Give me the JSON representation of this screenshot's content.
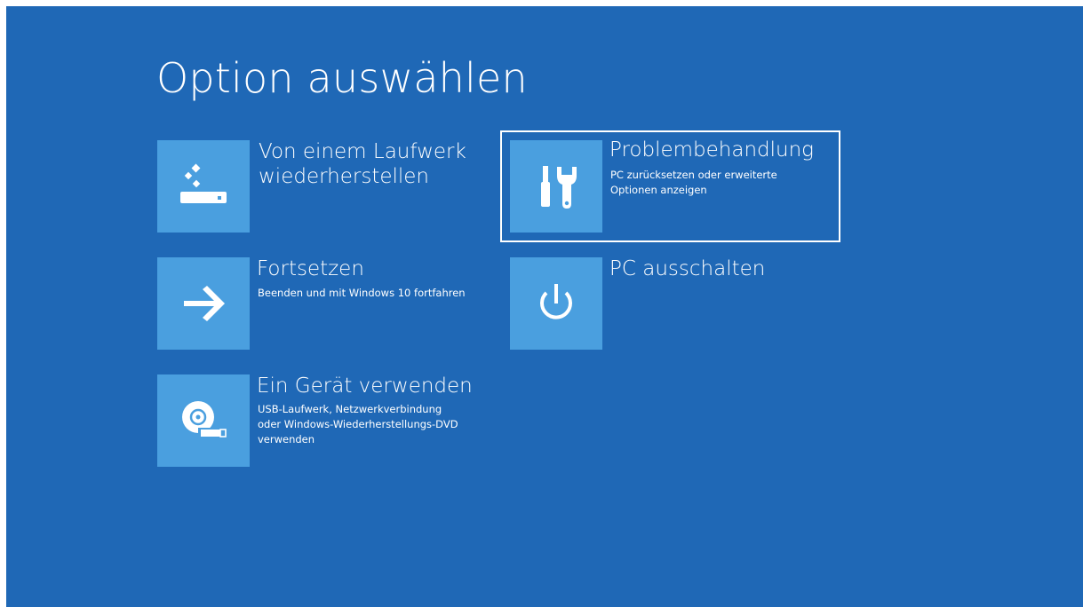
{
  "page": {
    "title": "Option auswählen",
    "background_color": "#1f68b6",
    "tile_color": "#4a9fdf"
  },
  "options": [
    {
      "id": "recover-drive",
      "title": "Von einem Laufwerk\nwiederherstellen",
      "description": "",
      "icon": "drive-recover-icon",
      "selected": false
    },
    {
      "id": "troubleshoot",
      "title": "Problembehandlung",
      "description": "PC zurücksetzen oder erweiterte\nOptionen anzeigen",
      "icon": "tools-icon",
      "selected": true
    },
    {
      "id": "continue",
      "title": "Fortsetzen",
      "description": "Beenden und mit Windows 10 fortfahren",
      "icon": "arrow-right-icon",
      "selected": false
    },
    {
      "id": "shutdown",
      "title": "PC ausschalten",
      "description": "",
      "icon": "power-icon",
      "selected": false
    },
    {
      "id": "use-device",
      "title": "Ein Gerät verwenden",
      "description": "USB-Laufwerk, Netzwerkverbindung\noder Windows-Wiederherstellungs-DVD\nverwenden",
      "icon": "disc-usb-icon",
      "selected": false
    }
  ]
}
